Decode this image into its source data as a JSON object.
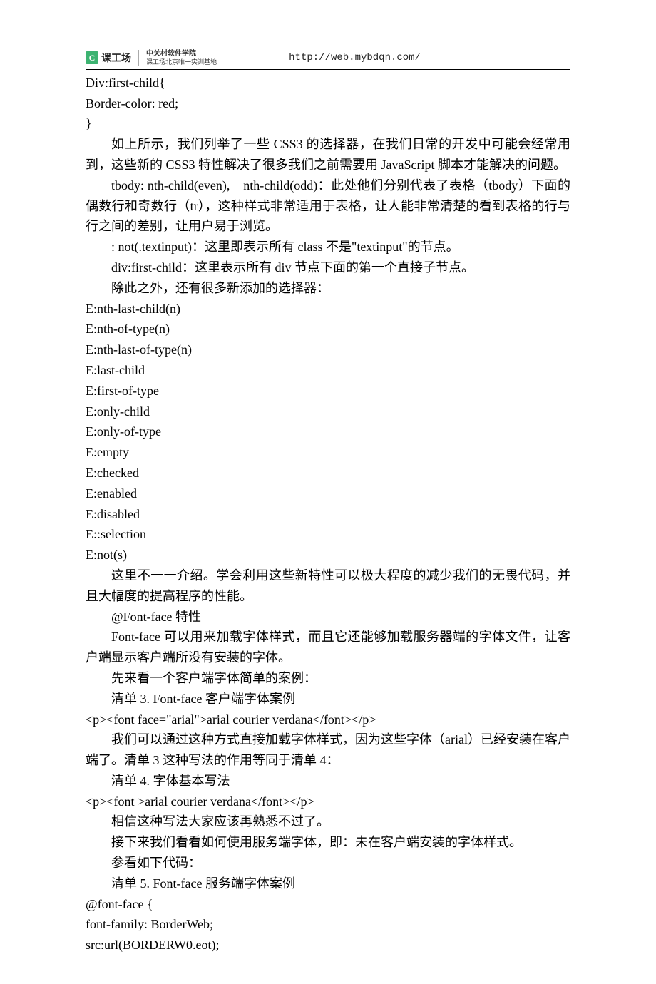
{
  "header": {
    "logo_text": "课工场",
    "tagline1": "中关村软件学院",
    "tagline2": "课工场北京唯一实训基地",
    "url": "http://web.mybdqn.com/"
  },
  "body": {
    "code1_l1": "Div:first-child{",
    "code1_l2": "Border-color: red;",
    "code1_l3": "}",
    "p1": "如上所示，我们列举了一些 CSS3 的选择器，在我们日常的开发中可能会经常用到，这些新的 CSS3 特性解决了很多我们之前需要用 JavaScript 脚本才能解决的问题。",
    "p2": "tbody: nth-child(even),　nth-child(odd)：此处他们分别代表了表格（tbody）下面的偶数行和奇数行（tr），这种样式非常适用于表格，让人能非常清楚的看到表格的行与行之间的差别，让用户易于浏览。",
    "p3": ": not(.textinput)：这里即表示所有 class 不是\"textinput\"的节点。",
    "p4": "div:first-child：这里表示所有 div 节点下面的第一个直接子节点。",
    "p5": "除此之外，还有很多新添加的选择器：",
    "sel": [
      "E:nth-last-child(n)",
      "E:nth-of-type(n)",
      "E:nth-last-of-type(n)",
      "E:last-child",
      "E:first-of-type",
      "E:only-child",
      "E:only-of-type",
      "E:empty",
      "E:checked",
      "E:enabled",
      "E:disabled",
      "E::selection",
      "E:not(s)"
    ],
    "p6": "这里不一一介绍。学会利用这些新特性可以极大程度的减少我们的无畏代码，并且大幅度的提高程序的性能。",
    "p7": "@Font-face 特性",
    "p8": "Font-face 可以用来加载字体样式，而且它还能够加载服务器端的字体文件，让客户端显示客户端所没有安装的字体。",
    "p9": "先来看一个客户端字体简单的案例：",
    "p10": "清单 3. Font-face 客户端字体案例",
    "code2": "<p><font face=\"arial\">arial courier verdana</font></p>",
    "p11": "我们可以通过这种方式直接加载字体样式，因为这些字体（arial）已经安装在客户端了。清单 3 这种写法的作用等同于清单 4：",
    "p12": "清单 4. 字体基本写法",
    "code3": "<p><font >arial courier verdana</font></p>",
    "p13": "相信这种写法大家应该再熟悉不过了。",
    "p14": "接下来我们看看如何使用服务端字体，即：未在客户端安装的字体样式。",
    "p15": "参看如下代码：",
    "p16": "清单 5. Font-face 服务端字体案例",
    "code4_l1": "@font-face {",
    "code4_l2": "font-family: BorderWeb;",
    "code4_l3": "src:url(BORDERW0.eot);"
  }
}
